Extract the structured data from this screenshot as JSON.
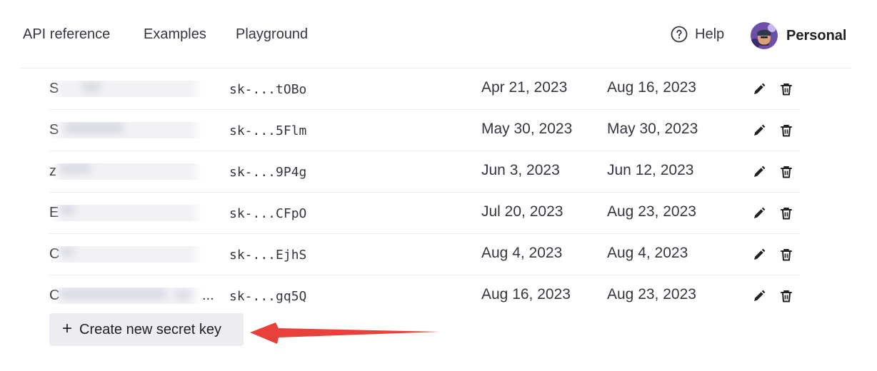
{
  "nav": {
    "links": [
      "API reference",
      "Examples",
      "Playground"
    ],
    "help_label": "Help",
    "account_label": "Personal"
  },
  "keys": [
    {
      "name_first": "S",
      "key": "sk-...tOBo",
      "created": "Apr 21, 2023",
      "last_used": "Aug 16, 2023"
    },
    {
      "name_first": "S",
      "key": "sk-...5Flm",
      "created": "May 30, 2023",
      "last_used": "May 30, 2023"
    },
    {
      "name_first": "z",
      "key": "sk-...9P4g",
      "created": "Jun 3, 2023",
      "last_used": "Jun 12, 2023"
    },
    {
      "name_first": "E",
      "key": "sk-...CFpO",
      "created": "Jul 20, 2023",
      "last_used": "Aug 23, 2023"
    },
    {
      "name_first": "C",
      "key": "sk-...EjhS",
      "created": "Aug 4, 2023",
      "last_used": "Aug 4, 2023"
    },
    {
      "name_first": "C",
      "name_suffix": "...",
      "key": "sk-...gq5Q",
      "created": "Aug 16, 2023",
      "last_used": "Aug 23, 2023"
    }
  ],
  "create_button_label": "Create new secret key",
  "icons": {
    "help": "question-circle-icon",
    "edit": "pencil-icon",
    "delete": "trash-icon",
    "create": "plus-icon",
    "annotation": "red-arrow-icon"
  },
  "colors": {
    "annotation": "#e8403a",
    "button_bg": "#ececf1",
    "divider": "#ececf1"
  }
}
